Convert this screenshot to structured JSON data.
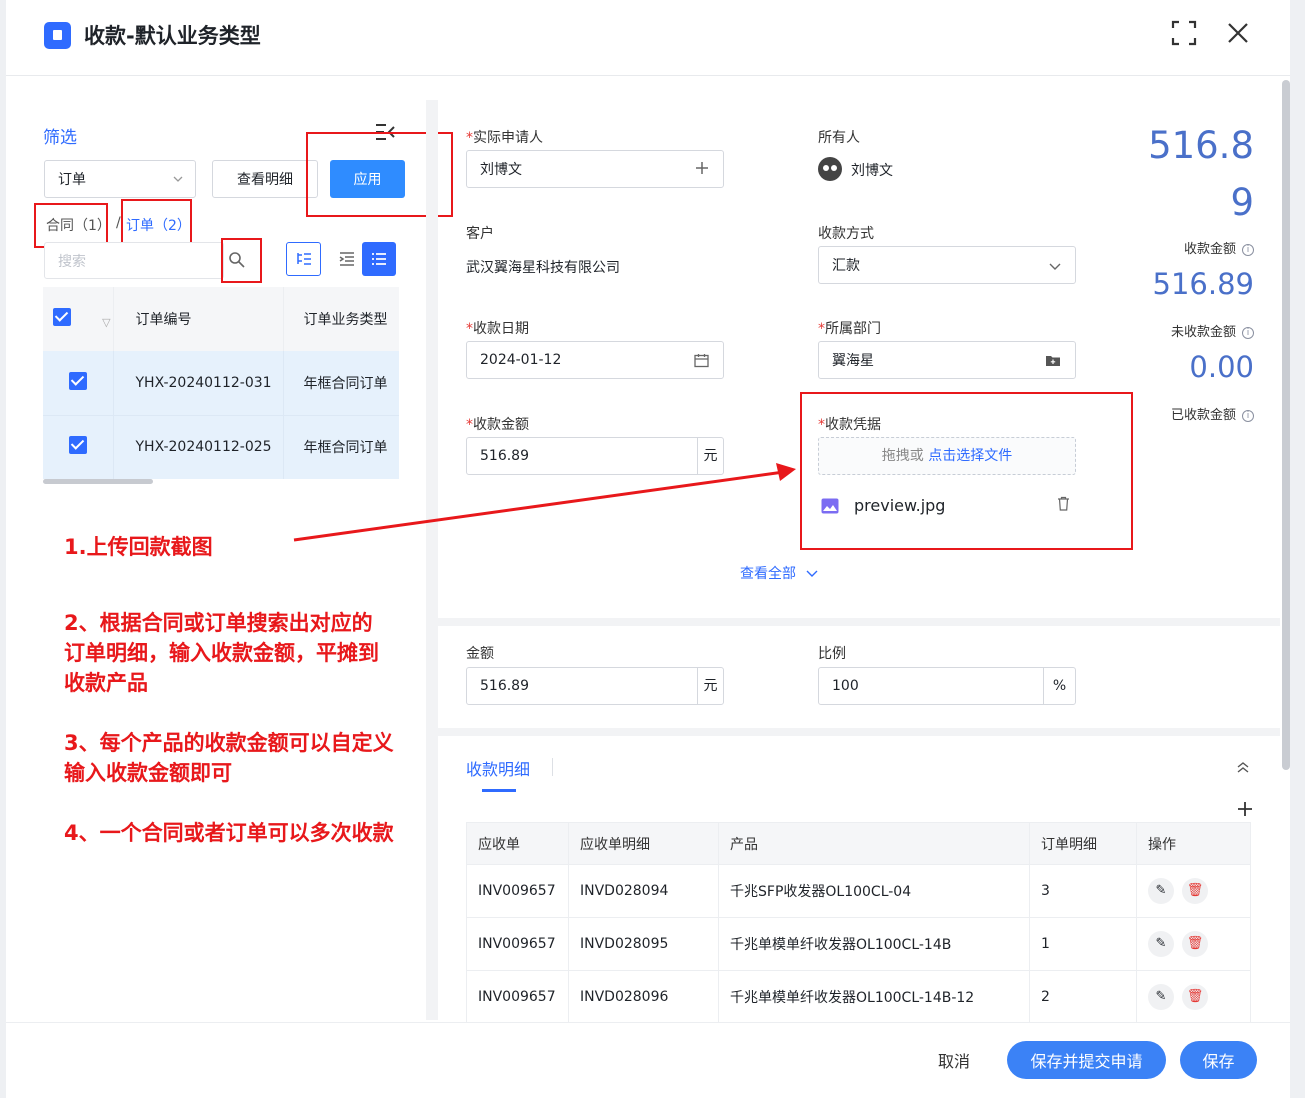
{
  "header": {
    "title": "收款-默认业务类型",
    "expand_icon": "expand-icon",
    "close_icon": "close-icon"
  },
  "filter": {
    "title": "筛选",
    "type_select": "订单",
    "view_detail_btn": "查看明细",
    "apply_btn": "应用",
    "tabs": {
      "contract": "合同（1）",
      "sep": "/",
      "order": "订单（2）"
    },
    "search_placeholder": "搜索",
    "table": {
      "headers": [
        "订单编号",
        "订单业务类型"
      ],
      "rows": [
        [
          "YHX-20240112-031",
          "年框合同订单"
        ],
        [
          "YHX-20240112-025",
          "年框合同订单"
        ]
      ]
    }
  },
  "annotations": [
    "1.上传回款截图",
    "2、根据合同或订单搜索出对应的\n订单明细，输入收款金额，平摊到\n收款产品",
    "3、每个产品的收款金额可以自定义\n输入收款金额即可",
    "4、一个合同或者订单可以多次收款"
  ],
  "form": {
    "applicant": {
      "label": "实际申请人",
      "value": "刘博文"
    },
    "owner": {
      "label": "所有人",
      "value": "刘博文"
    },
    "customer": {
      "label": "客户",
      "value": "武汉翼海星科技有限公司"
    },
    "method": {
      "label": "收款方式",
      "value": "汇款"
    },
    "date": {
      "label": "收款日期",
      "value": "2024-01-12"
    },
    "dept": {
      "label": "所属部门",
      "value": "翼海星"
    },
    "amount": {
      "label": "收款金额",
      "value": "516.89",
      "unit": "元"
    },
    "voucher": {
      "label": "收款凭据",
      "drop_text": "拖拽或 ",
      "drop_link": "点击选择文件",
      "file": "preview.jpg"
    },
    "view_all": "查看全部"
  },
  "summary": {
    "received_amount": "516.8\n9",
    "received_amount_label": "收款金额",
    "unreceived": "516.89",
    "unreceived_label": "未收款金额",
    "collected": "0.00",
    "collected_label": "已收款金额"
  },
  "amount_section": {
    "amount": {
      "label": "金额",
      "value": "516.89",
      "unit": "元"
    },
    "ratio": {
      "label": "比例",
      "value": "100",
      "unit": "%"
    }
  },
  "detail": {
    "tab": "收款明细",
    "headers": [
      "应收单",
      "应收单明细",
      "产品",
      "订单明细",
      "操作"
    ],
    "rows": [
      [
        "INV009657",
        "INVD028094",
        "千兆SFP收发器OL100CL-04",
        "3"
      ],
      [
        "INV009657",
        "INVD028095",
        "千兆单模单纤收发器OL100CL-14B",
        "1"
      ],
      [
        "INV009657",
        "INVD028096",
        "千兆单模单纤收发器OL100CL-14B-12",
        "2"
      ]
    ]
  },
  "footer": {
    "cancel": "取消",
    "save_submit": "保存并提交申请",
    "save": "保存"
  },
  "colors": {
    "primary": "#2f6bff",
    "annotation_red": "#e8181b",
    "number_blue": "#4a70c9"
  }
}
